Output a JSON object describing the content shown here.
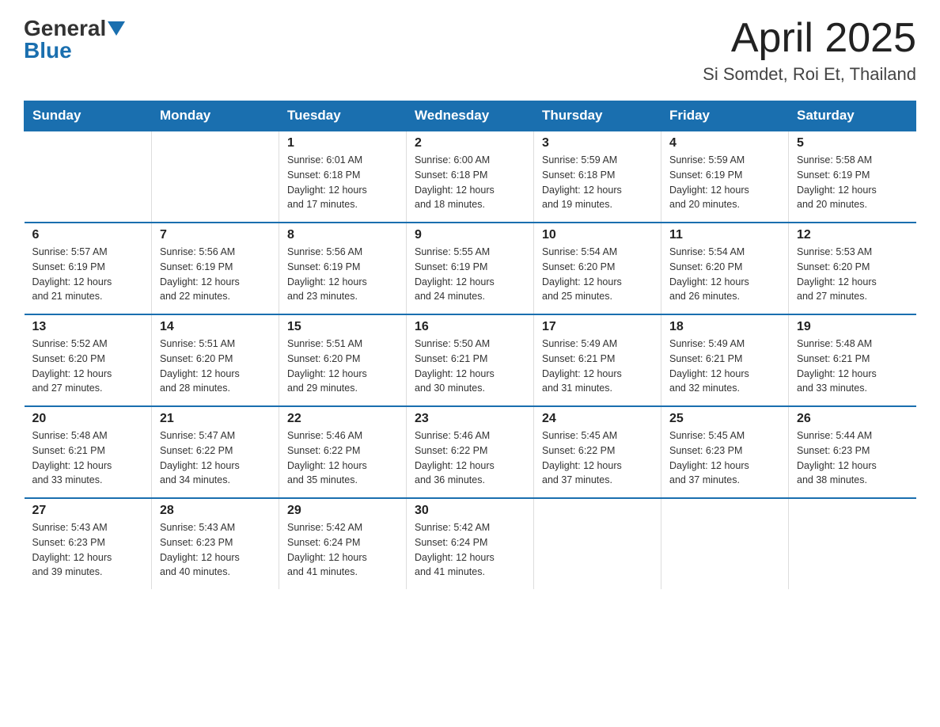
{
  "header": {
    "logo": {
      "general": "General",
      "blue": "Blue"
    },
    "title": "April 2025",
    "subtitle": "Si Somdet, Roi Et, Thailand"
  },
  "weekdays": [
    "Sunday",
    "Monday",
    "Tuesday",
    "Wednesday",
    "Thursday",
    "Friday",
    "Saturday"
  ],
  "weeks": [
    [
      {
        "day": "",
        "info": ""
      },
      {
        "day": "",
        "info": ""
      },
      {
        "day": "1",
        "info": "Sunrise: 6:01 AM\nSunset: 6:18 PM\nDaylight: 12 hours\nand 17 minutes."
      },
      {
        "day": "2",
        "info": "Sunrise: 6:00 AM\nSunset: 6:18 PM\nDaylight: 12 hours\nand 18 minutes."
      },
      {
        "day": "3",
        "info": "Sunrise: 5:59 AM\nSunset: 6:18 PM\nDaylight: 12 hours\nand 19 minutes."
      },
      {
        "day": "4",
        "info": "Sunrise: 5:59 AM\nSunset: 6:19 PM\nDaylight: 12 hours\nand 20 minutes."
      },
      {
        "day": "5",
        "info": "Sunrise: 5:58 AM\nSunset: 6:19 PM\nDaylight: 12 hours\nand 20 minutes."
      }
    ],
    [
      {
        "day": "6",
        "info": "Sunrise: 5:57 AM\nSunset: 6:19 PM\nDaylight: 12 hours\nand 21 minutes."
      },
      {
        "day": "7",
        "info": "Sunrise: 5:56 AM\nSunset: 6:19 PM\nDaylight: 12 hours\nand 22 minutes."
      },
      {
        "day": "8",
        "info": "Sunrise: 5:56 AM\nSunset: 6:19 PM\nDaylight: 12 hours\nand 23 minutes."
      },
      {
        "day": "9",
        "info": "Sunrise: 5:55 AM\nSunset: 6:19 PM\nDaylight: 12 hours\nand 24 minutes."
      },
      {
        "day": "10",
        "info": "Sunrise: 5:54 AM\nSunset: 6:20 PM\nDaylight: 12 hours\nand 25 minutes."
      },
      {
        "day": "11",
        "info": "Sunrise: 5:54 AM\nSunset: 6:20 PM\nDaylight: 12 hours\nand 26 minutes."
      },
      {
        "day": "12",
        "info": "Sunrise: 5:53 AM\nSunset: 6:20 PM\nDaylight: 12 hours\nand 27 minutes."
      }
    ],
    [
      {
        "day": "13",
        "info": "Sunrise: 5:52 AM\nSunset: 6:20 PM\nDaylight: 12 hours\nand 27 minutes."
      },
      {
        "day": "14",
        "info": "Sunrise: 5:51 AM\nSunset: 6:20 PM\nDaylight: 12 hours\nand 28 minutes."
      },
      {
        "day": "15",
        "info": "Sunrise: 5:51 AM\nSunset: 6:20 PM\nDaylight: 12 hours\nand 29 minutes."
      },
      {
        "day": "16",
        "info": "Sunrise: 5:50 AM\nSunset: 6:21 PM\nDaylight: 12 hours\nand 30 minutes."
      },
      {
        "day": "17",
        "info": "Sunrise: 5:49 AM\nSunset: 6:21 PM\nDaylight: 12 hours\nand 31 minutes."
      },
      {
        "day": "18",
        "info": "Sunrise: 5:49 AM\nSunset: 6:21 PM\nDaylight: 12 hours\nand 32 minutes."
      },
      {
        "day": "19",
        "info": "Sunrise: 5:48 AM\nSunset: 6:21 PM\nDaylight: 12 hours\nand 33 minutes."
      }
    ],
    [
      {
        "day": "20",
        "info": "Sunrise: 5:48 AM\nSunset: 6:21 PM\nDaylight: 12 hours\nand 33 minutes."
      },
      {
        "day": "21",
        "info": "Sunrise: 5:47 AM\nSunset: 6:22 PM\nDaylight: 12 hours\nand 34 minutes."
      },
      {
        "day": "22",
        "info": "Sunrise: 5:46 AM\nSunset: 6:22 PM\nDaylight: 12 hours\nand 35 minutes."
      },
      {
        "day": "23",
        "info": "Sunrise: 5:46 AM\nSunset: 6:22 PM\nDaylight: 12 hours\nand 36 minutes."
      },
      {
        "day": "24",
        "info": "Sunrise: 5:45 AM\nSunset: 6:22 PM\nDaylight: 12 hours\nand 37 minutes."
      },
      {
        "day": "25",
        "info": "Sunrise: 5:45 AM\nSunset: 6:23 PM\nDaylight: 12 hours\nand 37 minutes."
      },
      {
        "day": "26",
        "info": "Sunrise: 5:44 AM\nSunset: 6:23 PM\nDaylight: 12 hours\nand 38 minutes."
      }
    ],
    [
      {
        "day": "27",
        "info": "Sunrise: 5:43 AM\nSunset: 6:23 PM\nDaylight: 12 hours\nand 39 minutes."
      },
      {
        "day": "28",
        "info": "Sunrise: 5:43 AM\nSunset: 6:23 PM\nDaylight: 12 hours\nand 40 minutes."
      },
      {
        "day": "29",
        "info": "Sunrise: 5:42 AM\nSunset: 6:24 PM\nDaylight: 12 hours\nand 41 minutes."
      },
      {
        "day": "30",
        "info": "Sunrise: 5:42 AM\nSunset: 6:24 PM\nDaylight: 12 hours\nand 41 minutes."
      },
      {
        "day": "",
        "info": ""
      },
      {
        "day": "",
        "info": ""
      },
      {
        "day": "",
        "info": ""
      }
    ]
  ]
}
